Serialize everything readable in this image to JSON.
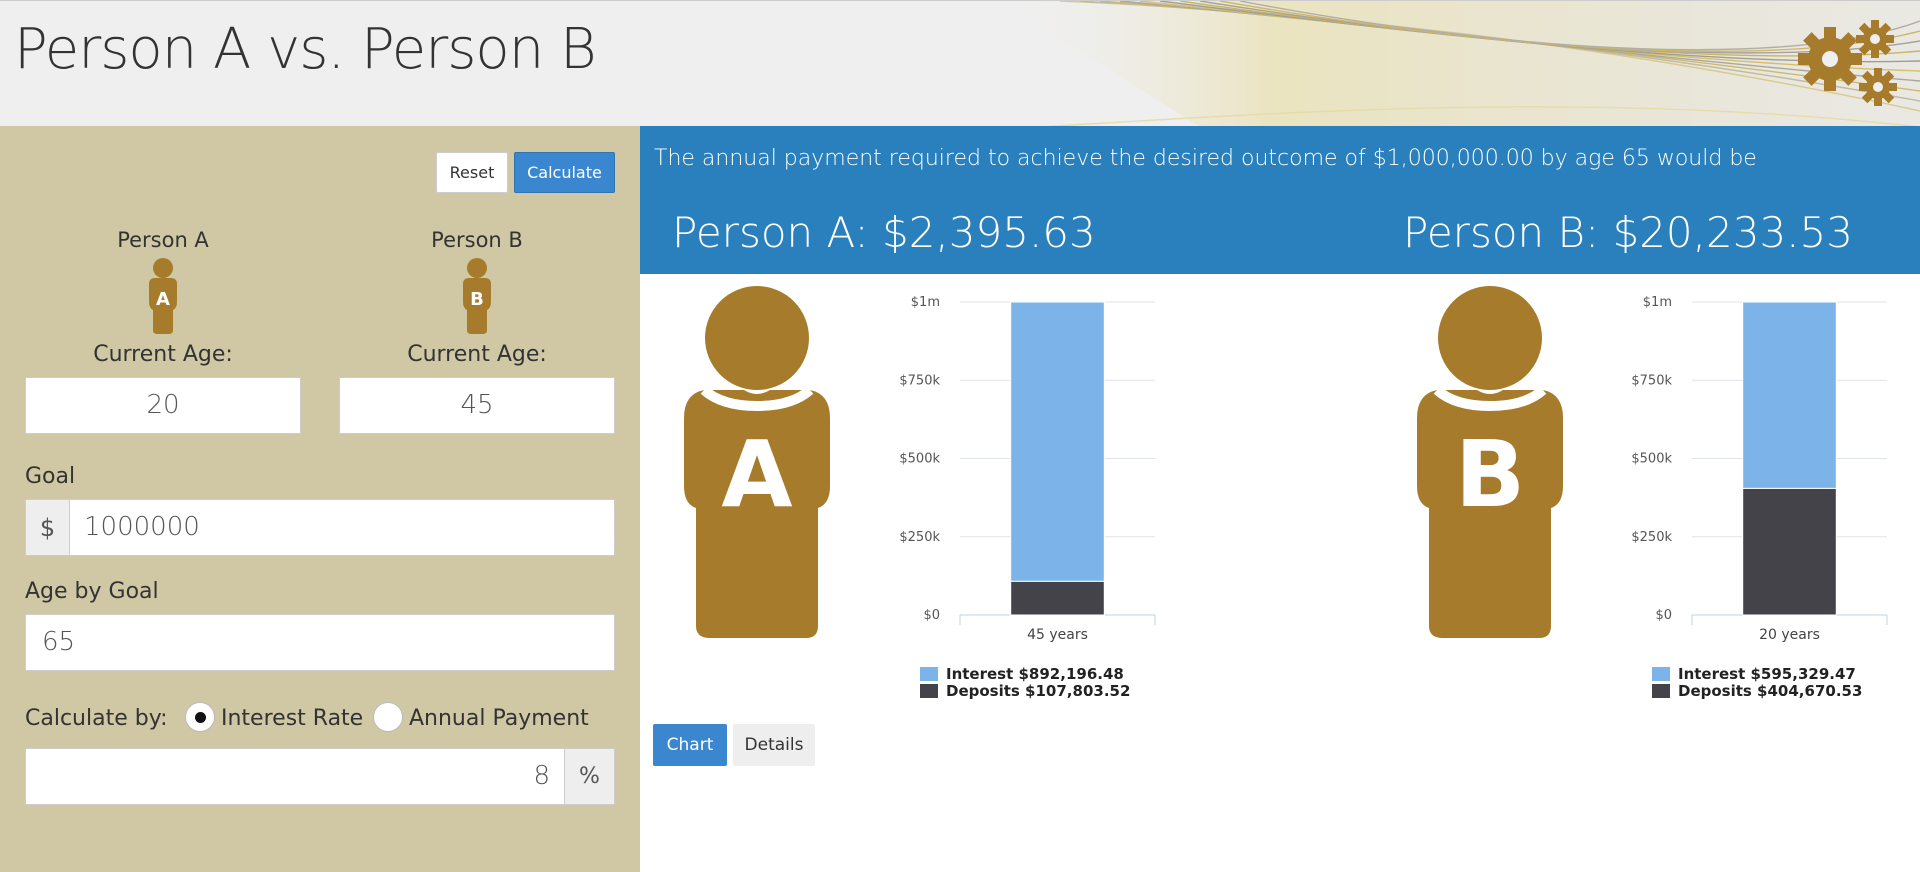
{
  "header": {
    "title": "Person A vs. Person B",
    "logo_icon": "gears-icon"
  },
  "colors": {
    "accent_blue": "#2a80bd",
    "button_blue": "#3b87cf",
    "figure_gold": "#a67c2c",
    "sidebar_bg": "#d0c8a4",
    "interest_color": "#7cb4ea",
    "deposits_color": "#434349"
  },
  "form": {
    "reset_label": "Reset",
    "calculate_label": "Calculate",
    "person_a": {
      "name": "Person A",
      "age_label": "Current Age:",
      "age": "20",
      "icon": "person-a-icon"
    },
    "person_b": {
      "name": "Person B",
      "age_label": "Current Age:",
      "age": "45",
      "icon": "person-b-icon"
    },
    "goal_label": "Goal",
    "goal_currency": "$",
    "goal_value": "1000000",
    "age_by_goal_label": "Age by Goal",
    "age_by_goal_value": "65",
    "calculate_by_label": "Calculate by:",
    "options": [
      {
        "label": "Interest Rate",
        "checked": true
      },
      {
        "label": "Annual Payment",
        "checked": false
      }
    ],
    "rate_value": "8",
    "rate_unit": "%"
  },
  "result": {
    "summary": "The annual payment required to achieve the desired outcome of $1,000,000.00 by age 65 would be",
    "person_a": "Person A: $2,395.63",
    "person_b": "Person B: $20,233.53"
  },
  "chart_data": [
    {
      "type": "bar",
      "stacked": true,
      "categories": [
        "45 years"
      ],
      "series": [
        {
          "name": "Interest",
          "values": [
            892196.48
          ]
        },
        {
          "name": "Deposits",
          "values": [
            107803.52
          ]
        }
      ],
      "yticks": [
        "$0",
        "$250k",
        "$500k",
        "$750k",
        "$1m"
      ],
      "ylim": [
        0,
        1000000
      ],
      "grid": true,
      "legend": [
        "Interest $892,196.48",
        "Deposits $107,803.52"
      ],
      "legend_placement": "bottom"
    },
    {
      "type": "bar",
      "stacked": true,
      "categories": [
        "20 years"
      ],
      "series": [
        {
          "name": "Interest",
          "values": [
            595329.47
          ]
        },
        {
          "name": "Deposits",
          "values": [
            404670.53
          ]
        }
      ],
      "yticks": [
        "$0",
        "$250k",
        "$500k",
        "$750k",
        "$1m"
      ],
      "ylim": [
        0,
        1000000
      ],
      "grid": true,
      "legend": [
        "Interest $595,329.47",
        "Deposits $404,670.53"
      ],
      "legend_placement": "bottom"
    }
  ],
  "tabs": [
    {
      "label": "Chart",
      "active": true
    },
    {
      "label": "Details",
      "active": false
    }
  ],
  "figures": {
    "a_letter": "A",
    "b_letter": "B"
  }
}
